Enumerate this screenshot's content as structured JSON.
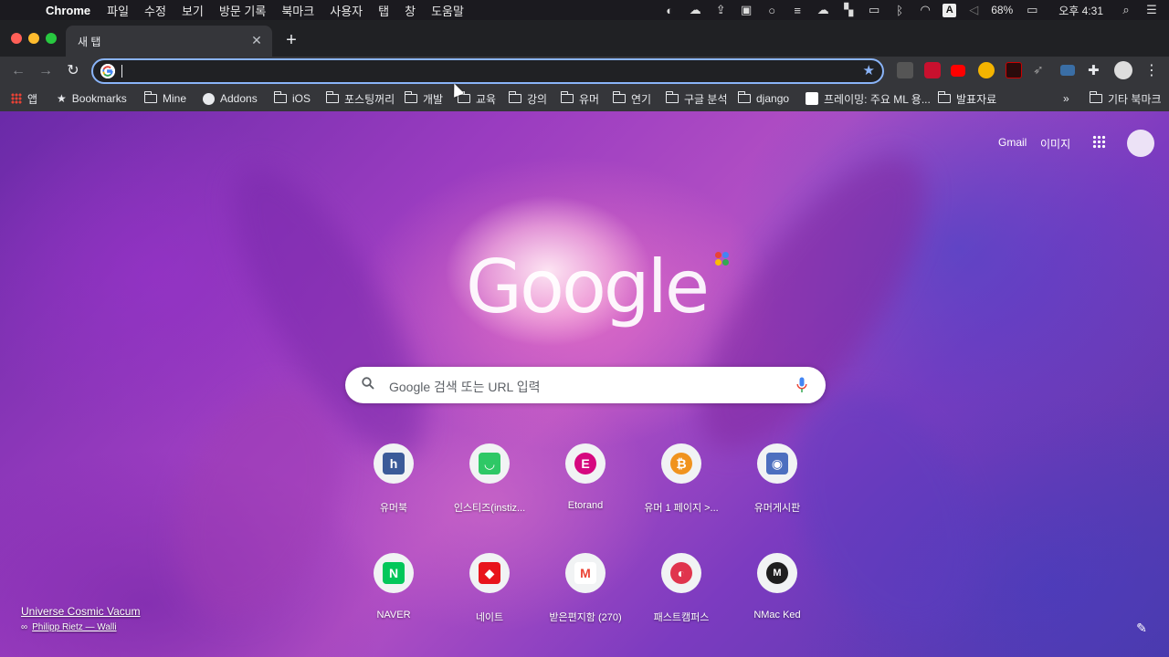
{
  "menubar": {
    "app_name": "Chrome",
    "items": [
      "파일",
      "수정",
      "보기",
      "방문 기록",
      "북마크",
      "사용자",
      "탭",
      "창",
      "도움말"
    ],
    "battery": "68%",
    "input_source": "A",
    "clock": "오후 4:31"
  },
  "tab": {
    "title": "새 탭"
  },
  "toolbar": {
    "omnibox_value": ""
  },
  "bookmarks": {
    "items": [
      "앱",
      "Bookmarks",
      "Mine",
      "Addons",
      "iOS",
      "포스팅꺼리",
      "개발",
      "교육",
      "강의",
      "유머",
      "연기",
      "구글 분석",
      "django",
      "프레이밍: 주요 ML 용...",
      "발표자료"
    ],
    "overflow": "»",
    "other": "기타 북마크"
  },
  "ntp": {
    "gmail": "Gmail",
    "images": "이미지",
    "logo": "Google",
    "search_placeholder": "Google 검색 또는 URL 입력",
    "shortcuts": [
      {
        "label": "유머북",
        "glyph": "h",
        "color": "#3b5b99"
      },
      {
        "label": "인스티즈(instiz...",
        "glyph": "◡",
        "color": "#2ec866"
      },
      {
        "label": "Etorand",
        "glyph": "E",
        "color": "#d6087f"
      },
      {
        "label": "유머 1 페이지 >...",
        "glyph": "₿",
        "color": "#f0931e"
      },
      {
        "label": "유머게시판",
        "glyph": "◉",
        "color": "#4c6fbf"
      },
      {
        "label": "NAVER",
        "glyph": "N",
        "color": "#03c75a"
      },
      {
        "label": "네이트",
        "glyph": "◆",
        "color": "#e8141c"
      },
      {
        "label": "받은편지함 (270)",
        "glyph": "M",
        "color": "#ea4335"
      },
      {
        "label": "패스트캠퍼스",
        "glyph": "◐",
        "color": "#e0344d"
      },
      {
        "label": "NMac Ked",
        "glyph": "M",
        "color": "#1f1f1f"
      }
    ],
    "attribution_title": "Universe Cosmic Vacum",
    "attribution_author": "Philipp Rietz — Walli"
  },
  "colors": {
    "accent": "#8ab4f8",
    "toolbar": "#35363a",
    "tabstrip": "#202124"
  }
}
